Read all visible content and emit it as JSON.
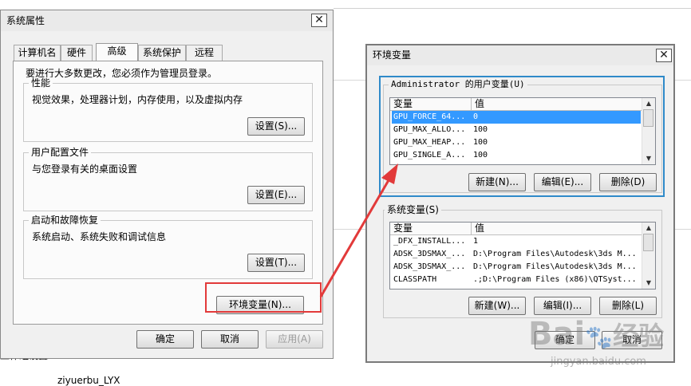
{
  "background_text": {
    "partial_label": "工作组设置",
    "username": "ziyuerbu_LYX"
  },
  "system_properties": {
    "title": "系统属性",
    "tabs": [
      {
        "label": "计算机名"
      },
      {
        "label": "硬件"
      },
      {
        "label": "高级"
      },
      {
        "label": "系统保护"
      },
      {
        "label": "远程"
      }
    ],
    "active_tab": "高级",
    "admin_notice": "要进行大多数更改，您必须作为管理员登录。",
    "performance": {
      "label": "性能",
      "description": "视觉效果，处理器计划，内存使用，以及虚拟内存",
      "settings_button": "设置(S)..."
    },
    "user_profiles": {
      "label": "用户配置文件",
      "description": "与您登录有关的桌面设置",
      "settings_button": "设置(E)..."
    },
    "startup_recovery": {
      "label": "启动和故障恢复",
      "description": "系统启动、系统失败和调试信息",
      "settings_button": "设置(T)..."
    },
    "env_vars_button": "环境变量(N)...",
    "ok_button": "确定",
    "cancel_button": "取消",
    "apply_button": "应用(A)"
  },
  "environment_variables": {
    "title": "环境变量",
    "user_vars": {
      "label": "Administrator 的用户变量(U)",
      "columns": {
        "name": "变量",
        "value": "值"
      },
      "rows": [
        {
          "name": "GPU_FORCE_64...",
          "value": "0",
          "selected": true
        },
        {
          "name": "GPU_MAX_ALLO...",
          "value": "100"
        },
        {
          "name": "GPU_MAX_HEAP...",
          "value": "100"
        },
        {
          "name": "GPU_SINGLE_A...",
          "value": "100"
        }
      ],
      "new_button": "新建(N)...",
      "edit_button": "编辑(E)...",
      "delete_button": "删除(D)"
    },
    "system_vars": {
      "label": "系统变量(S)",
      "columns": {
        "name": "变量",
        "value": "值"
      },
      "rows": [
        {
          "name": "_DFX_INSTALL...",
          "value": "1"
        },
        {
          "name": "ADSK_3DSMAX_...",
          "value": "D:\\Program Files\\Autodesk\\3ds M..."
        },
        {
          "name": "ADSK_3DSMAX_...",
          "value": "D:\\Program Files\\Autodesk\\3ds M..."
        },
        {
          "name": "CLASSPATH",
          "value": ".;D:\\Program Files (x86)\\QTSyst..."
        }
      ],
      "new_button": "新建(W)...",
      "edit_button": "编辑(I)...",
      "delete_button": "删除(L)"
    },
    "ok_button": "确定",
    "cancel_button": "取消"
  },
  "watermark": {
    "brand": "Bai",
    "brand_cn": "经验",
    "url": "jingyan.baidu.com"
  },
  "colors": {
    "highlight_blue": "#2f8ac9",
    "annotation_red": "#e23a3a",
    "selection": "#3399ff"
  }
}
